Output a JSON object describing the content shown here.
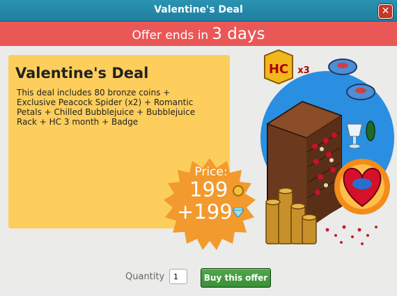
{
  "window": {
    "title": "Valentine's Deal",
    "close_glyph": "✕"
  },
  "offer_bar": {
    "prefix": "Offer ends in",
    "value": "3 days"
  },
  "deal": {
    "title": "Valentine's Deal",
    "description": "This deal includes 80 bronze coins + Exclusive Peacock Spider (x2) + Romantic Petals + Chilled Bubblejuice + Bubblejuice Rack + HC 3 month + Badge"
  },
  "price": {
    "label": "Price:",
    "credits": "199",
    "diamonds": "+199",
    "credit_icon": "coin-icon",
    "diamond_icon": "diamond-icon"
  },
  "art": {
    "hc_text": "HC",
    "hc_multiplier": "x3"
  },
  "footer": {
    "quantity_label": "Quantity",
    "quantity_value": "1",
    "buy_label": "Buy this offer"
  },
  "colors": {
    "titlebar": "#1f7f9f",
    "offer_bar": "#ea5757",
    "card": "#fece5c",
    "buy_button": "#3b8f38",
    "price_burst": "#f29a2e"
  }
}
